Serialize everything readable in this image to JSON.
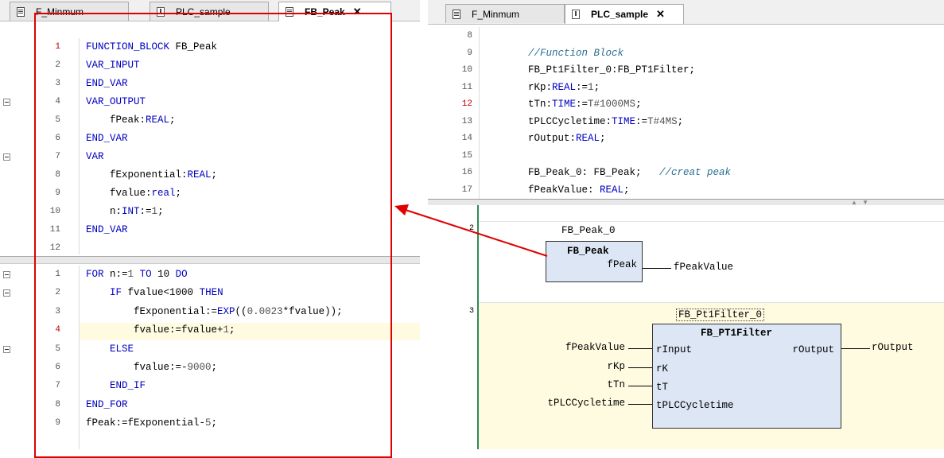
{
  "left_editor": {
    "tabs": [
      {
        "label": "F_Minmum",
        "active": false
      },
      {
        "label": "PLC_sample",
        "active": false
      },
      {
        "label": "FB_Peak",
        "active": true
      }
    ],
    "close_glyph": "✕",
    "decl_lines": [
      {
        "n": "1",
        "text": "FUNCTION_BLOCK FB_Peak"
      },
      {
        "n": "2",
        "text": "VAR_INPUT"
      },
      {
        "n": "3",
        "text": "END_VAR"
      },
      {
        "n": "4",
        "text": "VAR_OUTPUT"
      },
      {
        "n": "5",
        "text": "    fPeak:REAL;"
      },
      {
        "n": "6",
        "text": "END_VAR"
      },
      {
        "n": "7",
        "text": "VAR"
      },
      {
        "n": "8",
        "text": "    fExponential:REAL;"
      },
      {
        "n": "9",
        "text": "    fvalue:real;"
      },
      {
        "n": "10",
        "text": "    n:INT:=1;"
      },
      {
        "n": "11",
        "text": "END_VAR"
      },
      {
        "n": "12",
        "text": ""
      }
    ],
    "impl_lines": [
      {
        "n": "1",
        "text": "FOR n:=1 TO 10 DO"
      },
      {
        "n": "2",
        "text": "    IF fvalue<1000 THEN"
      },
      {
        "n": "3",
        "text": "        fExponential:=EXP((0.0023*fvalue));"
      },
      {
        "n": "4",
        "text": "        fvalue:=fvalue+1;"
      },
      {
        "n": "5",
        "text": "    ELSE"
      },
      {
        "n": "6",
        "text": "        fvalue:=-9000;"
      },
      {
        "n": "7",
        "text": "    END_IF"
      },
      {
        "n": "8",
        "text": "END_FOR"
      },
      {
        "n": "9",
        "text": "fPeak:=fExponential-5;"
      }
    ]
  },
  "right_editor": {
    "tabs": [
      {
        "label": "F_Minmum",
        "active": false
      },
      {
        "label": "PLC_sample",
        "active": true
      }
    ],
    "close_glyph": "✕",
    "decl_lines": [
      {
        "n": "8",
        "text": ""
      },
      {
        "n": "9",
        "text": "    //Function Block"
      },
      {
        "n": "10",
        "text": "    FB_Pt1Filter_0:FB_PT1Filter;"
      },
      {
        "n": "11",
        "text": "    rKp:REAL:=1;"
      },
      {
        "n": "12",
        "text": "    tTn:TIME:=T#1000MS;"
      },
      {
        "n": "13",
        "text": "    tPLCCycletime:TIME:=T#4MS;"
      },
      {
        "n": "14",
        "text": "    rOutput:REAL;"
      },
      {
        "n": "15",
        "text": ""
      },
      {
        "n": "16",
        "text": "    FB_Peak_0: FB_Peak;   //creat peak"
      },
      {
        "n": "17",
        "text": "    fPeakValue: REAL;"
      }
    ],
    "network2": {
      "number": "2",
      "instance": "FB_Peak_0",
      "type": "FB_Peak",
      "output_pin": "fPeak",
      "output_var": "fPeakValue"
    },
    "network3": {
      "number": "3",
      "instance": "FB_Pt1Filter_0",
      "type": "FB_PT1Filter",
      "inputs": [
        {
          "pin": "rInput",
          "var": "fPeakValue"
        },
        {
          "pin": "rK",
          "var": "rKp"
        },
        {
          "pin": "tT",
          "var": "tTn"
        },
        {
          "pin": "tPLCCycletime",
          "var": "tPLCCycletime"
        }
      ],
      "output_pin": "rOutput",
      "output_var": "rOutput"
    }
  },
  "colors": {
    "highlight_border": "#e00000",
    "keyword": "#0000c0",
    "comment": "#2a6f8f",
    "fbd_block": "#dce6f4",
    "network_bg_selected": "#fffbe0",
    "gutter_green": "#2e8b57"
  }
}
